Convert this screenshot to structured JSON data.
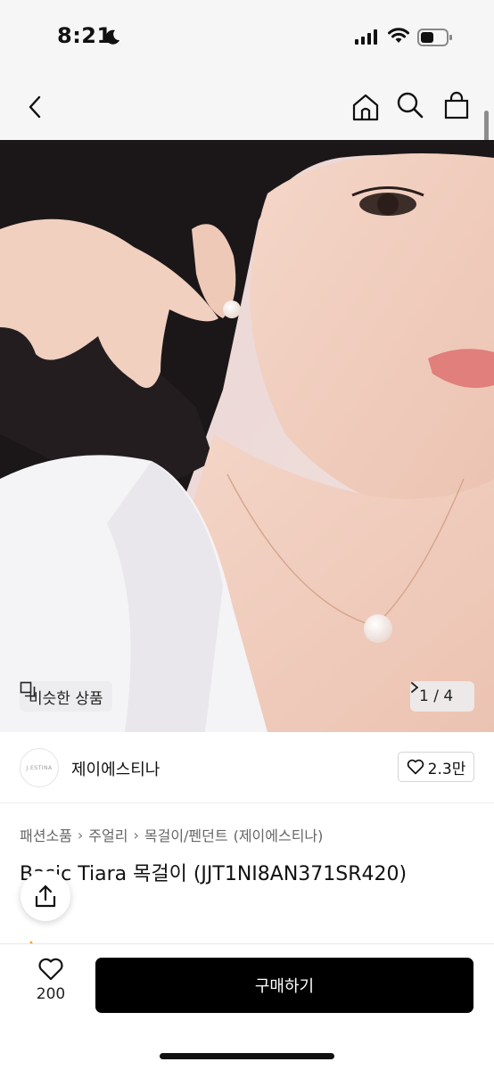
{
  "status": {
    "time": "8:21"
  },
  "nav": {
    "back_icon": "chevron-left-icon",
    "home_icon": "home-icon",
    "search_icon": "search-icon",
    "bag_icon": "shopping-bag-icon"
  },
  "hero": {
    "similar_label": "비슷한 상품",
    "counter": "1 / 4"
  },
  "shop": {
    "logo_text": "J.ESTINA",
    "name": "제이에스티나",
    "likes": "2.3만"
  },
  "breadcrumb": [
    "패션소품",
    "주얼리",
    "목걸이/펜던트",
    "(제이에스티나)"
  ],
  "product": {
    "title": "Basic Tiara 목걸이 (JJT1NI8AN371SR420)"
  },
  "bottom": {
    "wish_count": "200",
    "buy_label": "구매하기"
  },
  "colors": {
    "accent": "#000000",
    "background": "#ffffff",
    "nav_bg": "#f6f6f7"
  }
}
